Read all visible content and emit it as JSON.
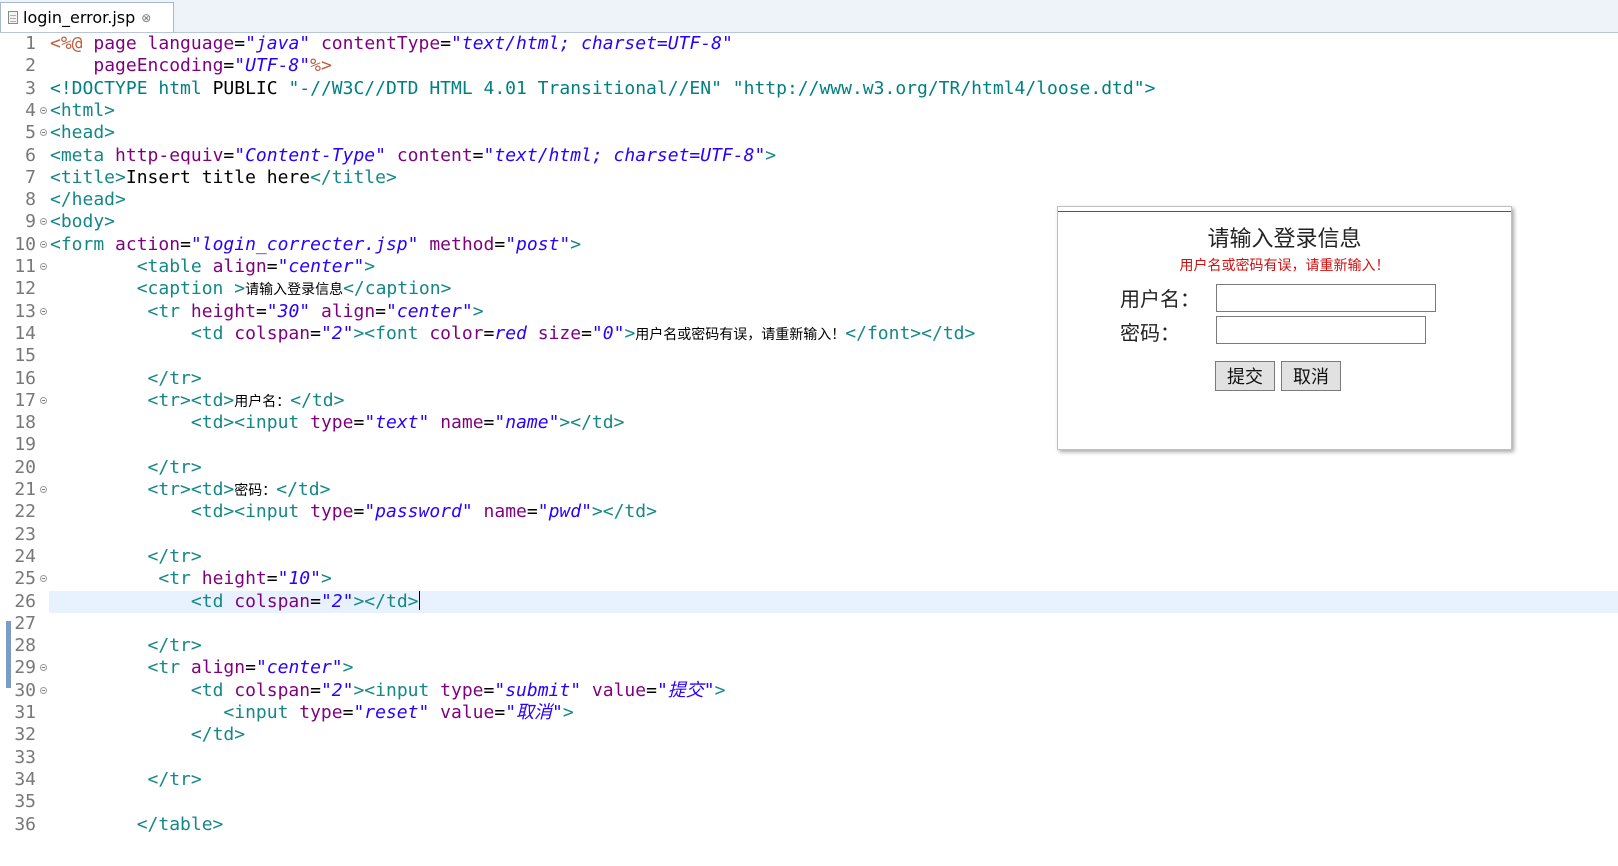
{
  "tab": {
    "title": "login_error.jsp",
    "close_symbol": "⊗",
    "icon": "jsp-file-icon"
  },
  "editor": {
    "current_line": 26,
    "lines": [
      {
        "n": "1",
        "fold": false,
        "tokens": [
          [
            "dir",
            "<%@ "
          ],
          [
            "attr",
            "page "
          ],
          [
            "attr",
            "language"
          ],
          [
            "txt",
            "="
          ],
          [
            "val",
            "\"java\""
          ],
          [
            "txt",
            " "
          ],
          [
            "attr",
            "contentType"
          ],
          [
            "txt",
            "="
          ],
          [
            "val",
            "\"text/html; charset=UTF-8\""
          ]
        ]
      },
      {
        "n": "2",
        "fold": false,
        "tokens": [
          [
            "txt",
            "    "
          ],
          [
            "attr",
            "pageEncoding"
          ],
          [
            "txt",
            "="
          ],
          [
            "val",
            "\"UTF-8\""
          ],
          [
            "dir",
            "%>"
          ]
        ]
      },
      {
        "n": "3",
        "fold": false,
        "tokens": [
          [
            "doc",
            "<!DOCTYPE "
          ],
          [
            "doc",
            "html"
          ],
          [
            "txt",
            " PUBLIC "
          ],
          [
            "doc",
            "\"-//W3C//DTD HTML 4.01 Transitional//EN\""
          ],
          [
            "txt",
            " "
          ],
          [
            "doc",
            "\"http://www.w3.org/TR/html4/loose.dtd\""
          ],
          [
            "doc",
            ">"
          ]
        ]
      },
      {
        "n": "4",
        "fold": true,
        "tokens": [
          [
            "tag",
            "<html>"
          ]
        ]
      },
      {
        "n": "5",
        "fold": true,
        "tokens": [
          [
            "tag",
            "<head>"
          ]
        ]
      },
      {
        "n": "6",
        "fold": false,
        "tokens": [
          [
            "tag",
            "<meta "
          ],
          [
            "attr",
            "http-equiv"
          ],
          [
            "txt",
            "="
          ],
          [
            "val",
            "\"Content-Type\""
          ],
          [
            "txt",
            " "
          ],
          [
            "attr",
            "content"
          ],
          [
            "txt",
            "="
          ],
          [
            "val",
            "\"text/html; charset=UTF-8\""
          ],
          [
            "tag",
            ">"
          ]
        ]
      },
      {
        "n": "7",
        "fold": false,
        "tokens": [
          [
            "tag",
            "<title>"
          ],
          [
            "txt",
            "Insert title here"
          ],
          [
            "tag",
            "</title>"
          ]
        ]
      },
      {
        "n": "8",
        "fold": false,
        "tokens": [
          [
            "tag",
            "</head>"
          ]
        ]
      },
      {
        "n": "9",
        "fold": true,
        "tokens": [
          [
            "tag",
            "<body>"
          ]
        ]
      },
      {
        "n": "10",
        "fold": true,
        "tokens": [
          [
            "tag",
            "<form "
          ],
          [
            "attr",
            "action"
          ],
          [
            "txt",
            "="
          ],
          [
            "val",
            "\"login_correcter.jsp\""
          ],
          [
            "txt",
            " "
          ],
          [
            "attr",
            "method"
          ],
          [
            "txt",
            "="
          ],
          [
            "val",
            "\"post\""
          ],
          [
            "tag",
            ">"
          ]
        ]
      },
      {
        "n": "11",
        "fold": true,
        "tokens": [
          [
            "txt",
            "        "
          ],
          [
            "tag",
            "<table "
          ],
          [
            "attr",
            "align"
          ],
          [
            "txt",
            "="
          ],
          [
            "val",
            "\"center\""
          ],
          [
            "tag",
            ">"
          ]
        ]
      },
      {
        "n": "12",
        "fold": false,
        "tokens": [
          [
            "txt",
            "        "
          ],
          [
            "tag",
            "<caption >"
          ],
          [
            "cjk",
            "请输入登录信息"
          ],
          [
            "tag",
            "</caption>"
          ]
        ]
      },
      {
        "n": "13",
        "fold": true,
        "tokens": [
          [
            "txt",
            "         "
          ],
          [
            "tag",
            "<tr "
          ],
          [
            "attr",
            "height"
          ],
          [
            "txt",
            "="
          ],
          [
            "val",
            "\"30\""
          ],
          [
            "txt",
            " "
          ],
          [
            "attr",
            "align"
          ],
          [
            "txt",
            "="
          ],
          [
            "val",
            "\"center\""
          ],
          [
            "tag",
            ">"
          ]
        ]
      },
      {
        "n": "14",
        "fold": false,
        "tokens": [
          [
            "txt",
            "             "
          ],
          [
            "tag",
            "<td "
          ],
          [
            "attr",
            "colspan"
          ],
          [
            "txt",
            "="
          ],
          [
            "val",
            "\"2\""
          ],
          [
            "tag",
            "><font "
          ],
          [
            "attr",
            "color"
          ],
          [
            "txt",
            "="
          ],
          [
            "val",
            "red"
          ],
          [
            "txt",
            " "
          ],
          [
            "attr",
            "size"
          ],
          [
            "txt",
            "="
          ],
          [
            "val",
            "\"0\""
          ],
          [
            "tag",
            ">"
          ],
          [
            "cjk",
            "用户名或密码有误，请重新输入！"
          ],
          [
            "tag",
            "</font></td>"
          ]
        ]
      },
      {
        "n": "15",
        "fold": false,
        "tokens": []
      },
      {
        "n": "16",
        "fold": false,
        "tokens": [
          [
            "txt",
            "         "
          ],
          [
            "tag",
            "</tr>"
          ]
        ]
      },
      {
        "n": "17",
        "fold": true,
        "tokens": [
          [
            "txt",
            "         "
          ],
          [
            "tag",
            "<tr><td>"
          ],
          [
            "cjk",
            "用户名："
          ],
          [
            "tag",
            "</td>"
          ]
        ]
      },
      {
        "n": "18",
        "fold": false,
        "tokens": [
          [
            "txt",
            "             "
          ],
          [
            "tag",
            "<td><input "
          ],
          [
            "attr",
            "type"
          ],
          [
            "txt",
            "="
          ],
          [
            "val",
            "\"text\""
          ],
          [
            "txt",
            " "
          ],
          [
            "attr",
            "name"
          ],
          [
            "txt",
            "="
          ],
          [
            "val",
            "\"name\""
          ],
          [
            "tag",
            "></td>"
          ]
        ]
      },
      {
        "n": "19",
        "fold": false,
        "tokens": []
      },
      {
        "n": "20",
        "fold": false,
        "tokens": [
          [
            "txt",
            "         "
          ],
          [
            "tag",
            "</tr>"
          ]
        ]
      },
      {
        "n": "21",
        "fold": true,
        "tokens": [
          [
            "txt",
            "         "
          ],
          [
            "tag",
            "<tr><td>"
          ],
          [
            "cjk",
            "密码："
          ],
          [
            "tag",
            "</td>"
          ]
        ]
      },
      {
        "n": "22",
        "fold": false,
        "tokens": [
          [
            "txt",
            "             "
          ],
          [
            "tag",
            "<td><input "
          ],
          [
            "attr",
            "type"
          ],
          [
            "txt",
            "="
          ],
          [
            "val",
            "\"password\""
          ],
          [
            "txt",
            " "
          ],
          [
            "attr",
            "name"
          ],
          [
            "txt",
            "="
          ],
          [
            "val",
            "\"pwd\""
          ],
          [
            "tag",
            "></td>"
          ]
        ]
      },
      {
        "n": "23",
        "fold": false,
        "tokens": []
      },
      {
        "n": "24",
        "fold": false,
        "tokens": [
          [
            "txt",
            "         "
          ],
          [
            "tag",
            "</tr>"
          ]
        ]
      },
      {
        "n": "25",
        "fold": true,
        "tokens": [
          [
            "txt",
            "          "
          ],
          [
            "tag",
            "<tr "
          ],
          [
            "attr",
            "height"
          ],
          [
            "txt",
            "="
          ],
          [
            "val",
            "\"10\""
          ],
          [
            "tag",
            ">"
          ]
        ]
      },
      {
        "n": "26",
        "fold": false,
        "tokens": [
          [
            "txt",
            "             "
          ],
          [
            "tag",
            "<td "
          ],
          [
            "attr",
            "colspan"
          ],
          [
            "txt",
            "="
          ],
          [
            "val",
            "\"2\""
          ],
          [
            "tag",
            "></td>"
          ]
        ]
      },
      {
        "n": "27",
        "fold": false,
        "tokens": []
      },
      {
        "n": "28",
        "fold": false,
        "tokens": [
          [
            "txt",
            "         "
          ],
          [
            "tag",
            "</tr>"
          ]
        ]
      },
      {
        "n": "29",
        "fold": true,
        "tokens": [
          [
            "txt",
            "         "
          ],
          [
            "tag",
            "<tr "
          ],
          [
            "attr",
            "align"
          ],
          [
            "txt",
            "="
          ],
          [
            "val",
            "\"center\""
          ],
          [
            "tag",
            ">"
          ]
        ]
      },
      {
        "n": "30",
        "fold": true,
        "tokens": [
          [
            "txt",
            "             "
          ],
          [
            "tag",
            "<td "
          ],
          [
            "attr",
            "colspan"
          ],
          [
            "txt",
            "="
          ],
          [
            "val",
            "\"2\""
          ],
          [
            "tag",
            "><input "
          ],
          [
            "attr",
            "type"
          ],
          [
            "txt",
            "="
          ],
          [
            "val",
            "\"submit\""
          ],
          [
            "txt",
            " "
          ],
          [
            "attr",
            "value"
          ],
          [
            "txt",
            "="
          ],
          [
            "val",
            "\"提交\""
          ],
          [
            "tag",
            ">"
          ]
        ]
      },
      {
        "n": "31",
        "fold": false,
        "tokens": [
          [
            "txt",
            "                "
          ],
          [
            "tag",
            "<input "
          ],
          [
            "attr",
            "type"
          ],
          [
            "txt",
            "="
          ],
          [
            "val",
            "\"reset\""
          ],
          [
            "txt",
            " "
          ],
          [
            "attr",
            "value"
          ],
          [
            "txt",
            "="
          ],
          [
            "val",
            "\"取消\""
          ],
          [
            "tag",
            ">"
          ]
        ]
      },
      {
        "n": "32",
        "fold": false,
        "tokens": [
          [
            "txt",
            "             "
          ],
          [
            "tag",
            "</td>"
          ]
        ]
      },
      {
        "n": "33",
        "fold": false,
        "tokens": []
      },
      {
        "n": "34",
        "fold": false,
        "tokens": [
          [
            "txt",
            "         "
          ],
          [
            "tag",
            "</tr>"
          ]
        ]
      },
      {
        "n": "35",
        "fold": false,
        "tokens": []
      },
      {
        "n": "36",
        "fold": false,
        "tokens": [
          [
            "txt",
            "        "
          ],
          [
            "tag",
            "</table>"
          ]
        ]
      }
    ]
  },
  "preview": {
    "caption": "请输入登录信息",
    "error_text": "用户名或密码有误，请重新输入！",
    "username_label": "用户名：",
    "username_value": "",
    "password_label": "密码：",
    "password_value": "",
    "submit_label": "提交",
    "reset_label": "取消"
  }
}
